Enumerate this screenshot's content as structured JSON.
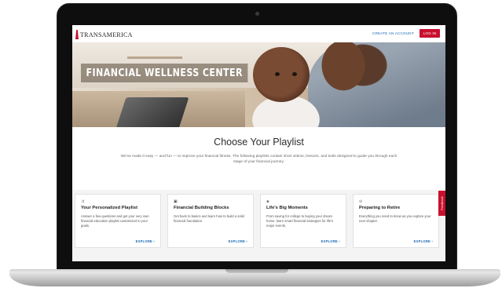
{
  "header": {
    "logo_text": "TRANSAMERICA",
    "create_account": "CREATE AN ACCOUNT",
    "login": "LOG IN"
  },
  "hero": {
    "title": "FINANCIAL WELLNESS CENTER"
  },
  "main": {
    "title": "Choose Your Playlist",
    "intro": "We've made it easy — and fun — to improve your financial fitness. The following playlists contain short videos, lessons, and tools designed to guide you through each stage of your financial journey."
  },
  "cards": [
    {
      "icon": "⤨",
      "title": "Your Personalized Playlist",
      "desc": "Answer a few questions and get your very own financial education playlist customized to your goals.",
      "link": "EXPLORE ›"
    },
    {
      "icon": "▣",
      "title": "Financial Building Blocks",
      "desc": "Get back to basics and learn how to build a solid financial foundation.",
      "link": "EXPLORE ›"
    },
    {
      "icon": "◈",
      "title": "Life's Big Moments",
      "desc": "From saving for college to buying your dream home, learn smart financial strategies for life's major events.",
      "link": "EXPLORE ›"
    },
    {
      "icon": "⊙",
      "title": "Preparing to Retire",
      "desc": "Everything you need to know as you explore your next chapter.",
      "link": "EXPLORE ›"
    }
  ],
  "feedback": "Feedback",
  "colors": {
    "brand_red": "#c8102e",
    "link_blue": "#1a67b3"
  }
}
